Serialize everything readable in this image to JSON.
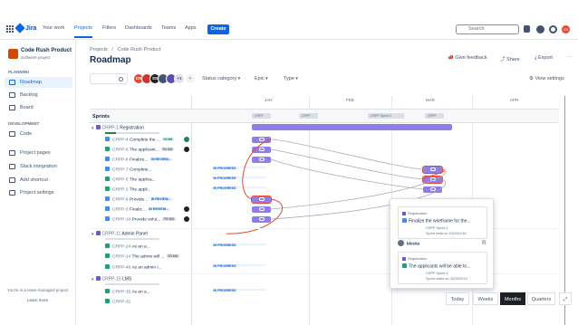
{
  "topnav": {
    "logo": "Jira",
    "items": [
      "Your work",
      "Projects",
      "Filters",
      "Dashboards",
      "Teams",
      "Apps"
    ],
    "create": "Create",
    "search_placeholder": "Search",
    "avatar": "CR"
  },
  "sidebar": {
    "project_name": "Code Rush Product",
    "project_type": "Software project",
    "planning_label": "PLANNING",
    "planning": [
      "Roadmap",
      "Backlog",
      "Board"
    ],
    "development_label": "DEVELOPMENT",
    "development": [
      "Code"
    ],
    "other": [
      "Project pages",
      "Slack integration",
      "Add shortcut",
      "Project settings"
    ],
    "footer_note": "You're in a team-managed project",
    "footer_link": "Learn more"
  },
  "header": {
    "breadcrumb_projects": "Projects",
    "breadcrumb_sep": "/",
    "breadcrumb_project": "Code Rush Product",
    "title": "Roadmap",
    "give_feedback": "Give feedback",
    "share": "Share",
    "export": "Export"
  },
  "filters": {
    "avatars": [
      "CR",
      "",
      "SS",
      "",
      "",
      "+1"
    ],
    "status": "Status category",
    "epic": "Epic",
    "type": "Type",
    "view_settings": "View settings"
  },
  "timeline": {
    "months": [
      "JAN",
      "FEB",
      "MAR",
      "APR"
    ],
    "sprints_label": "Sprints",
    "sprint_bars": [
      "CRPP",
      "CRPP",
      "CRPP Sprint 3",
      "CRPP"
    ]
  },
  "epics": [
    {
      "key": "CRPP-1",
      "name": "Registration",
      "items": [
        {
          "key": "CRPP-4",
          "title": "Complete the ...",
          "status": "DONE"
        },
        {
          "key": "CRPP-6",
          "title": "The applicant...",
          "status": "TO DO"
        },
        {
          "key": "CRPP-8",
          "title": "Finalize...",
          "status": "IN REVIEW..."
        },
        {
          "key": "CRPP-7",
          "title": "Complete...",
          "status": "IN PROGRESS"
        },
        {
          "key": "CRPP-5",
          "title": "The applica...",
          "status": "IN PROGRESS"
        },
        {
          "key": "CRPP-2",
          "title": "The appli...",
          "status": "IN PROGRESS"
        },
        {
          "key": "CRPP-9",
          "title": "Provide...",
          "status": "IN REVIEW..."
        },
        {
          "key": "CRPP-3",
          "title": "Finaliz...",
          "status": "IN REVIEW..."
        },
        {
          "key": "CRPP-10",
          "title": "Provide solut...",
          "status": "TO DO"
        }
      ]
    },
    {
      "key": "CRPP-11",
      "name": "Admin Panel",
      "items": [
        {
          "key": "CRPP-24",
          "title": "As an a...",
          "status": "IN PROGRESS"
        },
        {
          "key": "CRPP-14",
          "title": "The admin will ...",
          "status": "TO DO"
        },
        {
          "key": "CRPP-46",
          "title": "As an admin I...",
          "status": "IN PROGRESS"
        }
      ]
    },
    {
      "key": "CRPP-15",
      "name": "LMS",
      "items": [
        {
          "key": "CRPP-35",
          "title": "As an a...",
          "status": "IN PROGRESS"
        },
        {
          "key": "CRPP-31",
          "title": "",
          "status": ""
        }
      ]
    }
  ],
  "popup": {
    "card1_epic": "Registration",
    "card1_title": "Finalize the wireframe for the...",
    "card1_sprint": "CRPP Sprint 1",
    "card1_ends": "Sprint ends on 2023/01/16",
    "blocks_label": "blocks",
    "card2_epic": "Registration",
    "card2_title": "The applicants will be able to...",
    "card2_sprint": "CRPP Sprint 4",
    "card2_starts": "Sprint starts on 2023/03/13"
  },
  "zoom": [
    "Today",
    "Weeks",
    "Months",
    "Quarters"
  ],
  "colors": {
    "accent": "#0c66e4",
    "epic": "#8f7ee7",
    "today": "#f18d13",
    "dependency": "#e34935"
  }
}
